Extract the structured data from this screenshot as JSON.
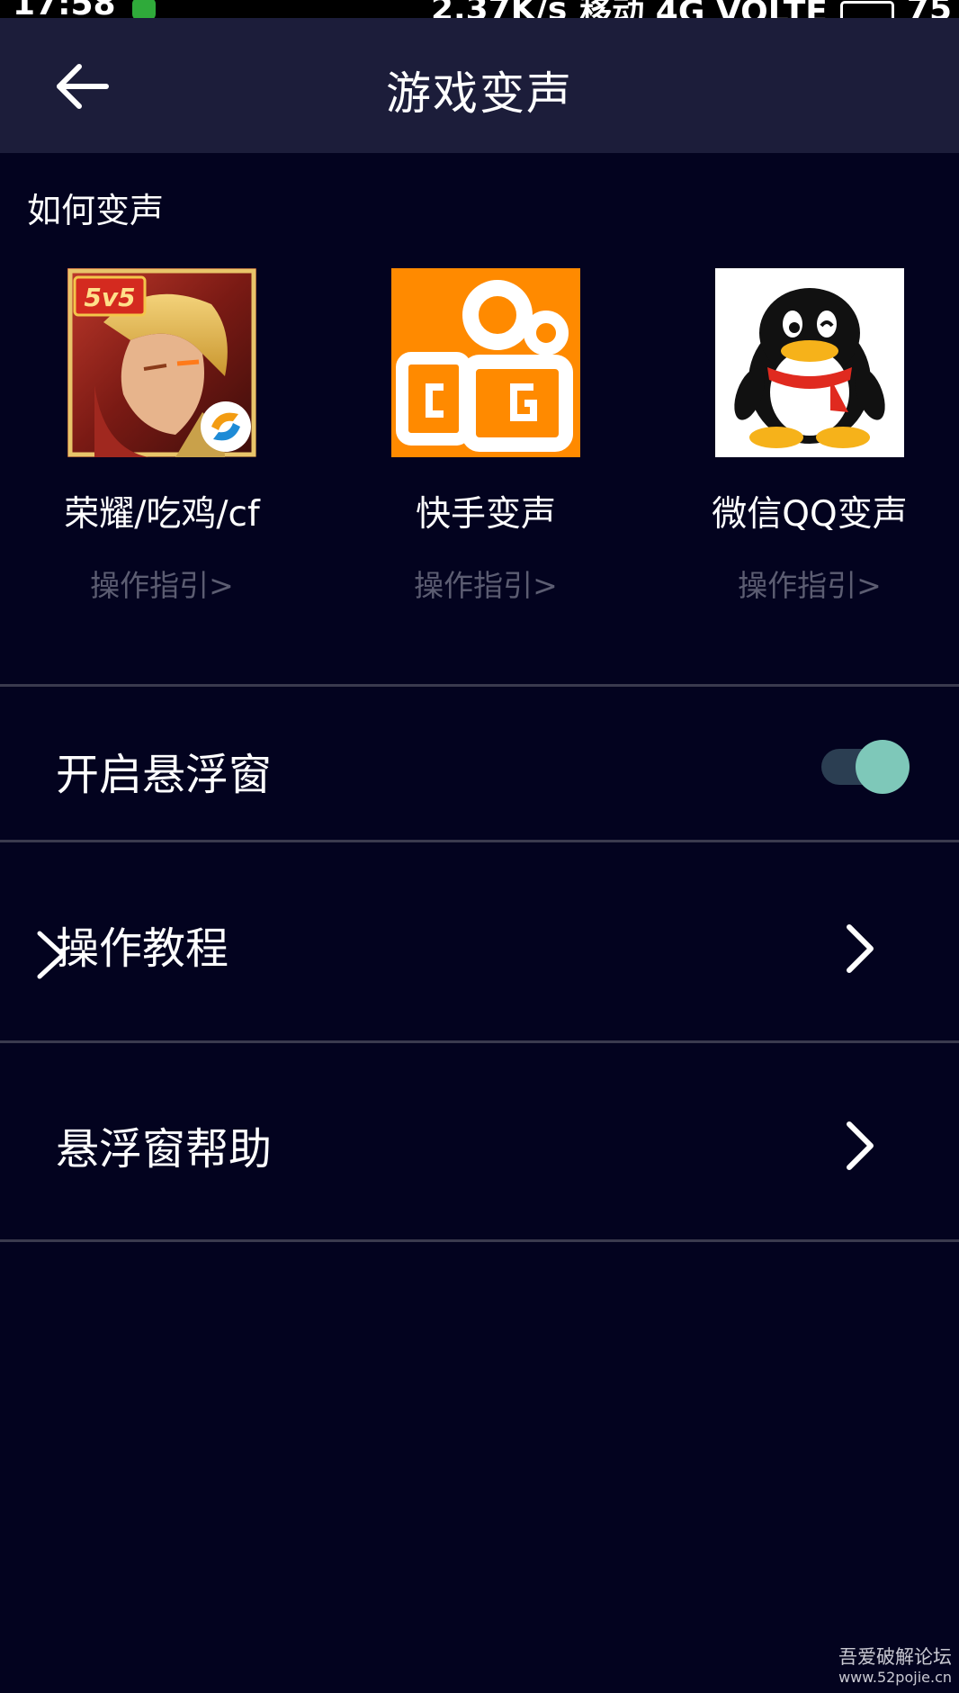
{
  "status_bar": {
    "time": "17:58",
    "net_speed": "2.37K/s",
    "carrier": "移动 4G VOLTE",
    "battery": "75"
  },
  "app_bar": {
    "back_icon": "arrow-left-icon",
    "title": "游戏变声"
  },
  "section": {
    "title": "如何变声"
  },
  "apps": [
    {
      "name": "荣耀/吃鸡/cf",
      "guide": "操作指引>",
      "icon": "honor-of-kings-icon",
      "icon_badge": "5v5"
    },
    {
      "name": "快手变声",
      "guide": "操作指引>",
      "icon": "kuaishou-icon"
    },
    {
      "name": "微信QQ变声",
      "guide": "操作指引>",
      "icon": "qq-penguin-icon"
    }
  ],
  "settings": {
    "floating_window": {
      "label": "开启悬浮窗",
      "enabled": true
    },
    "tutorial": {
      "label": "操作教程",
      "icon": "chevron-right-icon"
    },
    "help": {
      "label": "悬浮窗帮助",
      "icon": "chevron-right-icon"
    }
  },
  "watermark": {
    "name": "吾爱破解论坛",
    "url": "www.52pojie.cn"
  },
  "colors": {
    "background": "#03031f",
    "app_bar": "#1c1d3a",
    "divider": "#3a3a4e",
    "guide_text": "#5c5d72",
    "toggle_thumb": "#7ec8b9",
    "toggle_track": "#2b3e52",
    "kuaishou_orange": "#ff8a00"
  }
}
